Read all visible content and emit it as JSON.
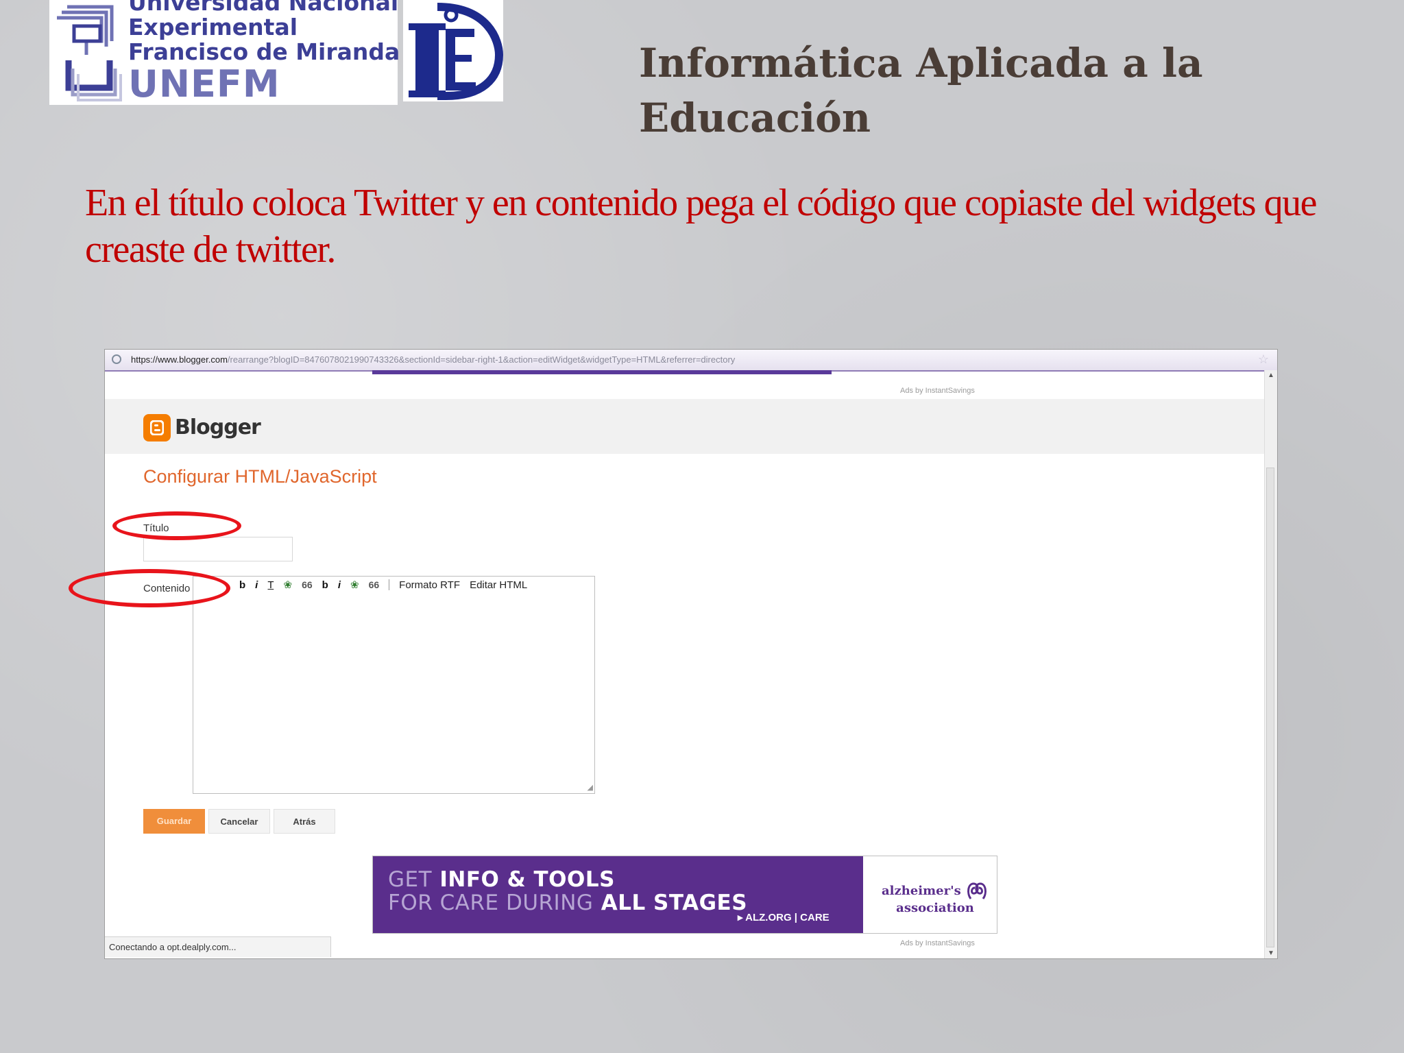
{
  "logos": {
    "university_lines": [
      "Universidad Nacional",
      "Experimental",
      "Francisco de Miranda"
    ],
    "university_acronym": "UNEFM"
  },
  "slide": {
    "title": "Informática Aplicada a la Educación",
    "instruction": "En el título coloca Twitter y en contenido pega el código que copiaste del widgets que creaste de twitter."
  },
  "browser": {
    "url_domain": "https://www.blogger.com",
    "url_path": "/rearrange?blogID=8476078021990743326&sectionId=sidebar-right-1&action=editWidget&widgetType=HTML&referrer=directory",
    "status": "Conectando a opt.dealply.com..."
  },
  "blogger": {
    "brand": "Blogger",
    "page_title": "Configurar HTML/JavaScript",
    "titulo_label": "Título",
    "titulo_value": "",
    "contenido_label": "Contenido",
    "contenido_value": "",
    "toolbar": {
      "bold": "b",
      "italic": "i",
      "quote": "66",
      "rich_text": "Formato RTF",
      "edit_html": "Editar HTML"
    },
    "buttons": {
      "save": "Guardar",
      "cancel": "Cancelar",
      "back": "Atrás"
    },
    "ads_label": "Ads by InstantSavings"
  },
  "banner": {
    "line1_dim": "GET",
    "line1_bold": "INFO & TOOLS",
    "line2_dim": "FOR CARE DURING",
    "line2_bold": "ALL STAGES",
    "link": "▸ ALZ.ORG | CARE",
    "org_line1": "alzheimer's",
    "org_line2": "association"
  },
  "colors": {
    "instruction_text": "#c00000",
    "title_text": "#4a3d36",
    "annotation_oval": "#e8141b",
    "blogger_orange": "#f57d00",
    "banner_purple": "#5a2e8c"
  }
}
